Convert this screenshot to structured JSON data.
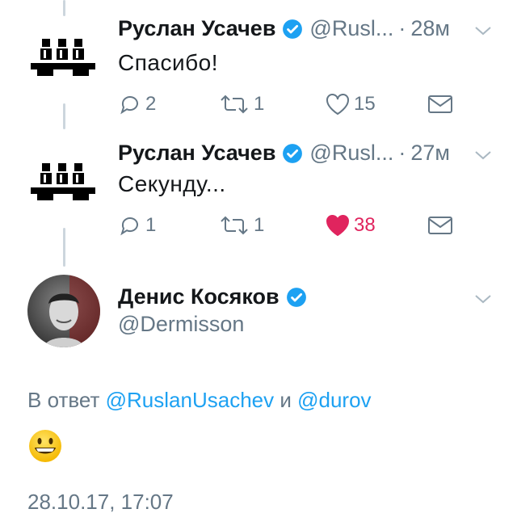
{
  "tweets": [
    {
      "author_name": "Руслан Усачев",
      "handle": "@Rusl...",
      "separator": "·",
      "time": "28м",
      "text": "Спасибо!",
      "reply_count": "2",
      "retweet_count": "1",
      "like_count": "15",
      "liked": false
    },
    {
      "author_name": "Руслан Усачев",
      "handle": "@Rusl...",
      "separator": "·",
      "time": "27м",
      "text": "Секунду...",
      "reply_count": "1",
      "retweet_count": "1",
      "like_count": "38",
      "liked": true
    }
  ],
  "main_tweet": {
    "author_name": "Денис Косяков",
    "handle": "@Dermisson",
    "reply_prefix": "В ответ",
    "mention_1": "@RuslanUsachev",
    "reply_conjunction": "и",
    "mention_2": "@durov",
    "emoji": "grinning-face",
    "date": "28.10.17, 17:07"
  },
  "colors": {
    "text": "#14171a",
    "muted": "#657786",
    "link": "#1da1f2",
    "like": "#e0245e",
    "verified": "#1da1f2",
    "thread_line": "#ccd6dd"
  },
  "icons": [
    "verified-badge-icon",
    "chevron-down-icon",
    "reply-icon",
    "retweet-icon",
    "heart-icon",
    "direct-message-icon"
  ]
}
